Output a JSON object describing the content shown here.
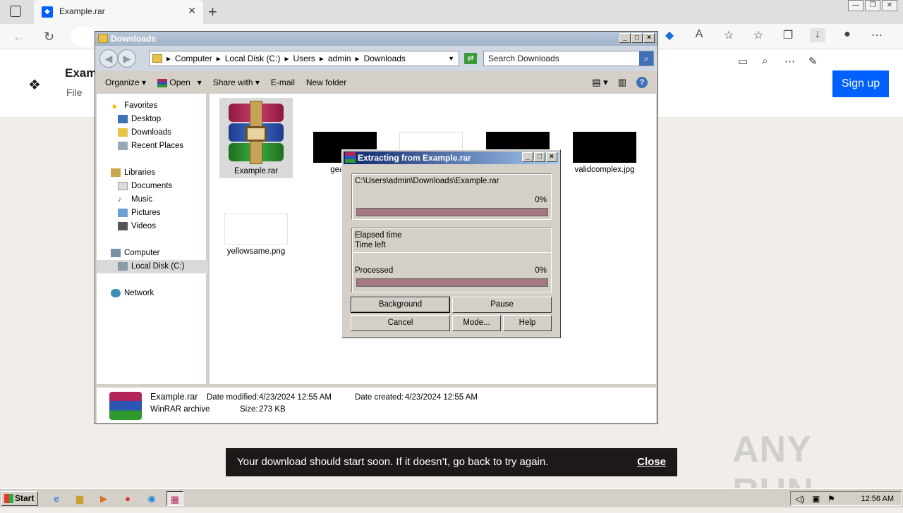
{
  "browser": {
    "tab_title": "Example.rar",
    "tab_close": "✕",
    "new_tab": "+",
    "window_buttons": [
      "—",
      "❐",
      "✕"
    ]
  },
  "page": {
    "title": "Exam",
    "subtitle": "File",
    "signup_label": "Sign up"
  },
  "explorer": {
    "title": "Downloads",
    "breadcrumb": [
      "Computer",
      "Local Disk (C:)",
      "Users",
      "admin",
      "Downloads"
    ],
    "search_placeholder": "Search Downloads",
    "toolbar": {
      "organize": "Organize",
      "open": "Open",
      "share_with": "Share with",
      "email": "E-mail",
      "new_folder": "New folder"
    },
    "nav": {
      "favorites": "Favorites",
      "desktop": "Desktop",
      "downloads": "Downloads",
      "recent_places": "Recent Places",
      "libraries": "Libraries",
      "documents": "Documents",
      "music": "Music",
      "pictures": "Pictures",
      "videos": "Videos",
      "computer": "Computer",
      "local_disk": "Local Disk (C:)",
      "network": "Network"
    },
    "files": {
      "f1": "Example.rar",
      "f2": "geardefi",
      "f3": "validcomplex.jpg",
      "f4": "yellowsame.png"
    },
    "details": {
      "name": "Example.rar",
      "type": "WinRAR archive",
      "modified_label": "Date modified:",
      "modified_value": "4/23/2024 12:55 AM",
      "size_label": "Size:",
      "size_value": "273 KB",
      "created_label": "Date created:",
      "created_value": "4/23/2024 12:55 AM"
    }
  },
  "dialog": {
    "title": "Extracting from Example.rar",
    "path": "C:\\Users\\admin\\Downloads\\Example.rar",
    "file_progress": "0%",
    "elapsed_label": "Elapsed time",
    "time_left_label": "Time left",
    "processed_label": "Processed",
    "processed_value": "0%",
    "buttons": {
      "background": "Background",
      "pause": "Pause",
      "cancel": "Cancel",
      "mode": "Mode...",
      "help": "Help"
    }
  },
  "toast": {
    "message": "Your download should start soon. If it doesn’t, go back to try again.",
    "close": "Close"
  },
  "watermark": "ANY RUN",
  "taskbar": {
    "start": "Start",
    "time": "12:56 AM"
  },
  "colors": {
    "dropbox_blue": "#0061fe",
    "toast_bg": "#1e1919",
    "progress_fill": "#a37880"
  }
}
